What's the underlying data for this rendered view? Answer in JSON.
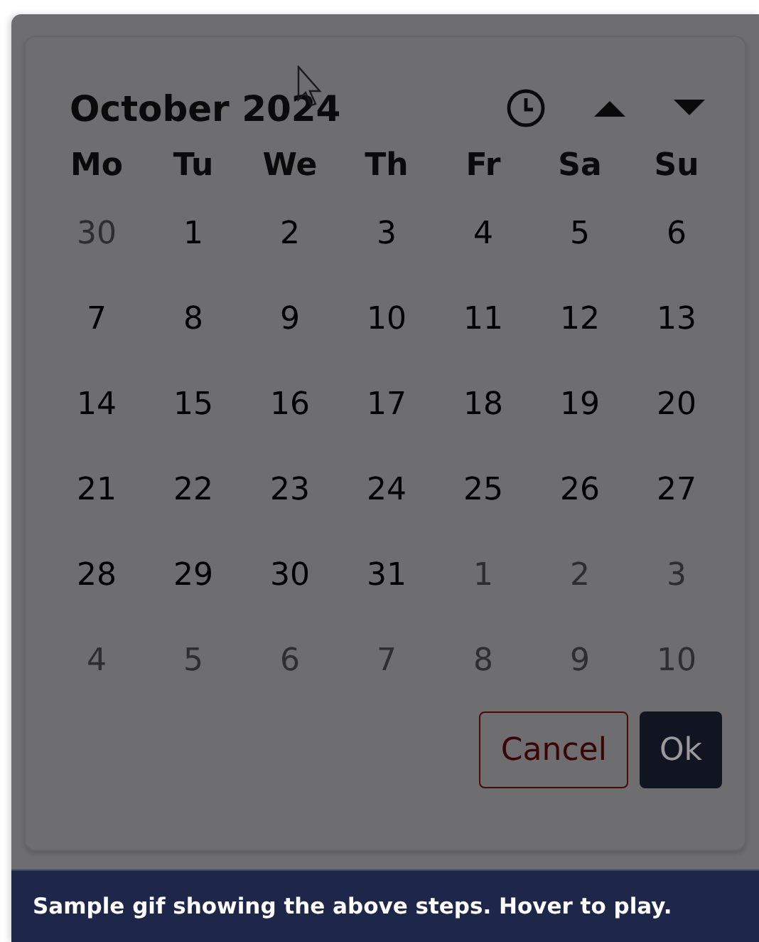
{
  "calendar": {
    "title": "October 2024",
    "weekdays": [
      "Mo",
      "Tu",
      "We",
      "Th",
      "Fr",
      "Sa",
      "Su"
    ],
    "weeks": [
      [
        {
          "day": "30",
          "muted": true
        },
        {
          "day": "1",
          "muted": false
        },
        {
          "day": "2",
          "muted": false
        },
        {
          "day": "3",
          "muted": false
        },
        {
          "day": "4",
          "muted": false
        },
        {
          "day": "5",
          "muted": false
        },
        {
          "day": "6",
          "muted": false
        }
      ],
      [
        {
          "day": "7",
          "muted": false
        },
        {
          "day": "8",
          "muted": false
        },
        {
          "day": "9",
          "muted": false
        },
        {
          "day": "10",
          "muted": false
        },
        {
          "day": "11",
          "muted": false
        },
        {
          "day": "12",
          "muted": false
        },
        {
          "day": "13",
          "muted": false
        }
      ],
      [
        {
          "day": "14",
          "muted": false
        },
        {
          "day": "15",
          "muted": false
        },
        {
          "day": "16",
          "muted": false
        },
        {
          "day": "17",
          "muted": false
        },
        {
          "day": "18",
          "muted": false
        },
        {
          "day": "19",
          "muted": false
        },
        {
          "day": "20",
          "muted": false
        }
      ],
      [
        {
          "day": "21",
          "muted": false
        },
        {
          "day": "22",
          "muted": false
        },
        {
          "day": "23",
          "muted": false
        },
        {
          "day": "24",
          "muted": false
        },
        {
          "day": "25",
          "muted": false
        },
        {
          "day": "26",
          "muted": false
        },
        {
          "day": "27",
          "muted": false
        }
      ],
      [
        {
          "day": "28",
          "muted": false
        },
        {
          "day": "29",
          "muted": false
        },
        {
          "day": "30",
          "muted": false
        },
        {
          "day": "31",
          "muted": false
        },
        {
          "day": "1",
          "muted": true
        },
        {
          "day": "2",
          "muted": true
        },
        {
          "day": "3",
          "muted": true
        }
      ],
      [
        {
          "day": "4",
          "muted": true
        },
        {
          "day": "5",
          "muted": true
        },
        {
          "day": "6",
          "muted": true
        },
        {
          "day": "7",
          "muted": true
        },
        {
          "day": "8",
          "muted": true
        },
        {
          "day": "9",
          "muted": true
        },
        {
          "day": "10",
          "muted": true
        }
      ]
    ],
    "buttons": [
      {
        "label": "Cancel",
        "kind": "secondary"
      },
      {
        "label": "Ok",
        "kind": "primary"
      }
    ]
  },
  "caption": "Sample gif showing the above steps. Hover to play."
}
